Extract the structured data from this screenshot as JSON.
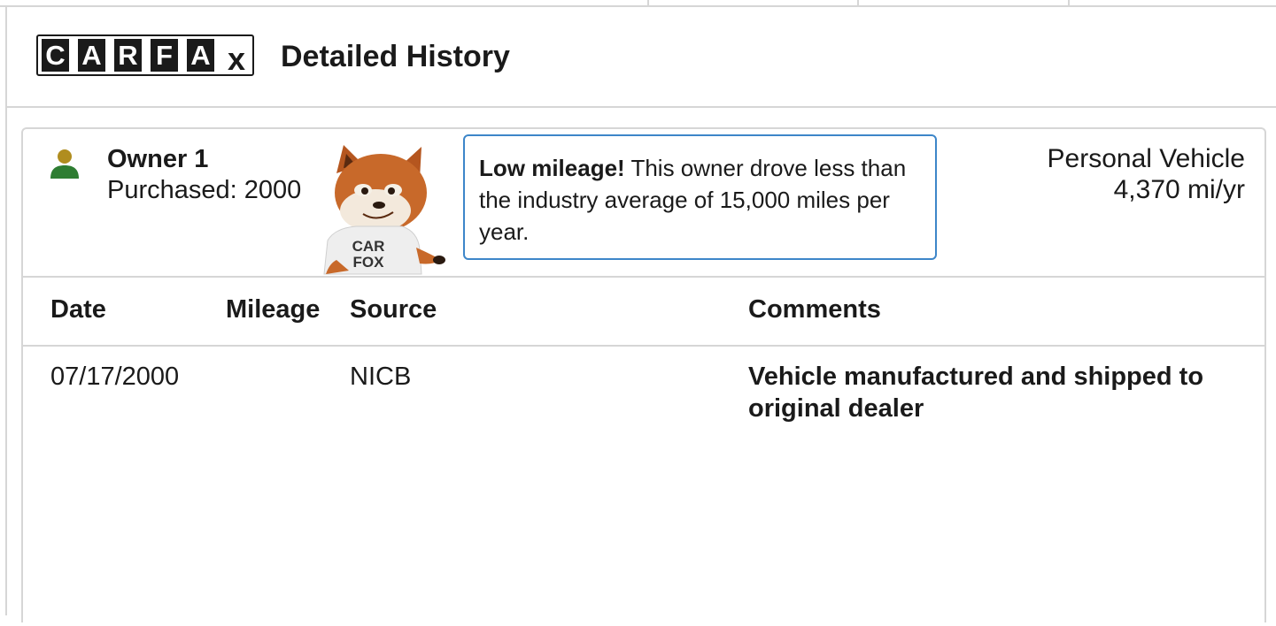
{
  "logo": {
    "letters": [
      "C",
      "A",
      "R",
      "F",
      "A"
    ],
    "suffix": "x"
  },
  "header": {
    "title": "Detailed History"
  },
  "owner": {
    "title": "Owner 1",
    "purchased": "Purchased: 2000",
    "icon": "person-icon",
    "icon_colors": {
      "head": "#b08d1f",
      "body": "#2e7d32"
    }
  },
  "mascot": {
    "shirt_line1": "CAR",
    "shirt_line2": "FOX"
  },
  "callout": {
    "bold": "Low mileage!",
    "text": " This owner drove less than the industry average of 15,000 miles per year."
  },
  "vehicle": {
    "type": "Personal Vehicle",
    "miles": "4,370 mi/yr"
  },
  "table": {
    "headers": {
      "date": "Date",
      "mileage": "Mileage",
      "source": "Source",
      "comments": "Comments"
    },
    "rows": [
      {
        "date": "07/17/2000",
        "mileage": "",
        "source": "NICB",
        "comments": "Vehicle manufactured and shipped to original dealer"
      }
    ]
  },
  "colors": {
    "callout_border": "#3d86c9",
    "border": "#d6d6d6"
  }
}
